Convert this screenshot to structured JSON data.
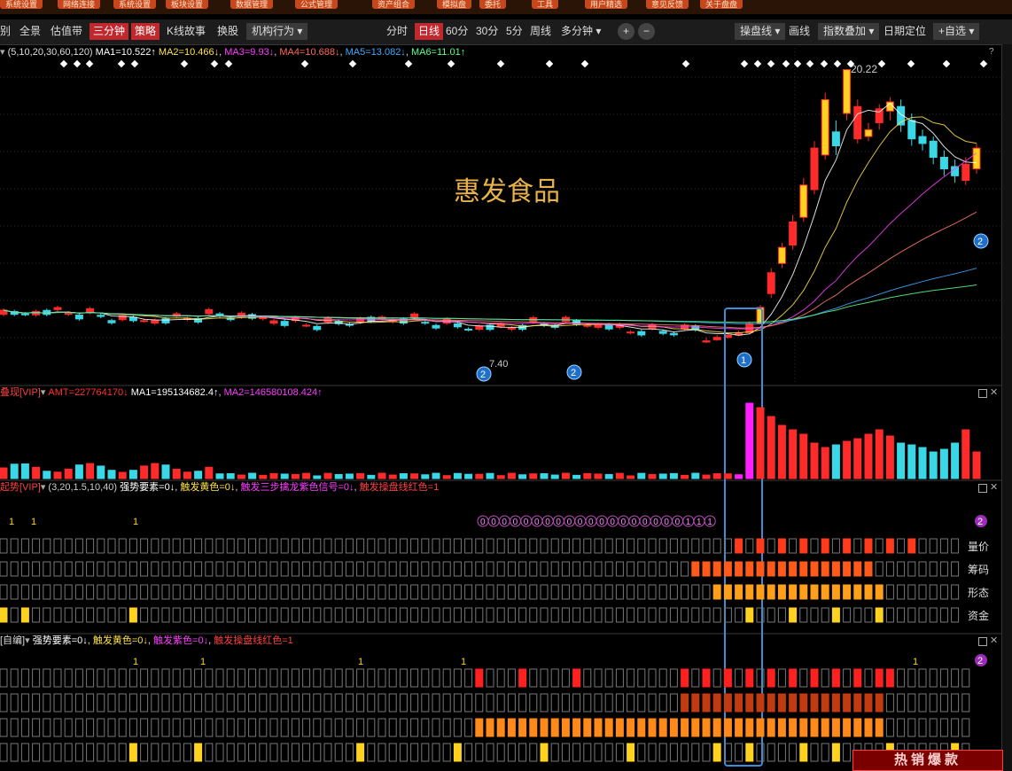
{
  "top_menu": [
    "系统设置",
    "网络连接",
    "系统设置",
    "板块设置",
    "数据管理",
    "公式管理",
    "资产组合",
    "模拟盘",
    "委托",
    "工具",
    "用户精选",
    "意见反馈",
    "关于盘盘"
  ],
  "toolbar": {
    "left_tabs": [
      "别",
      "全景",
      "估值带",
      "三分钟",
      "策略",
      "K线故事",
      "换股",
      "机构行为"
    ],
    "period_tabs": [
      "分时",
      "日线",
      "60分",
      "30分",
      "5分",
      "周线",
      "多分钟"
    ],
    "zoom_in": "+",
    "zoom_out": "−",
    "right_tabs": [
      "操盘线",
      "画线",
      "指数叠加",
      "日期定位",
      "+自选"
    ]
  },
  "ma_bar": {
    "params": "(5,10,20,30,60,120)",
    "ma1": "MA1=10.522↑",
    "ma2": "MA2=10.466↓",
    "ma3": "MA3=9.93↓",
    "ma4": "MA4=10.688↓",
    "ma5": "MA5=13.082↓",
    "ma6": "MA6=11.01↑",
    "help": "?"
  },
  "price_chart": {
    "stock_name": "惠发食品",
    "high_label": "20.22",
    "low_label": "7.40",
    "markers": [
      "2",
      "2",
      "1",
      "2"
    ]
  },
  "amount_bar": {
    "name": "叠现[VIP]",
    "amt": "AMT=227764170↓",
    "ma1": "MA1=195134682.4↑",
    "ma2": "MA2=146580108.424↑"
  },
  "indicator1_bar": {
    "name": "起势[VIP]",
    "params": "(3,20,1.5,10,40)",
    "f1": "强势要素=0↓",
    "f2": "触发黄色=0↓",
    "f3": "触发三步擒龙紫色信号=0↓",
    "f4": "触发操盘线红色=1"
  },
  "indicator1_rows": [
    "量价",
    "筹码",
    "形态",
    "资金"
  ],
  "indicator1_left_ones": [
    "1",
    "1",
    "1"
  ],
  "indicator1_digits": "0000000000000000000111",
  "indicator1_tail": "2",
  "indicator2_bar": {
    "name": "[自编]",
    "f1": "强势要素=0↓",
    "f2": "触发黄色=0↓",
    "f3": "触发紫色=0↓",
    "f4": "触发操盘线红色=1"
  },
  "indicator2_ones": [
    "1",
    "1",
    "1",
    "1",
    "1"
  ],
  "indicator2_tail": "2",
  "watermark": "热销爆款",
  "colors": {
    "up": "#ff2a2a",
    "down": "#3ad7e6",
    "yellow": "#ffd21f",
    "magenta": "#ff1fff",
    "orange": "#ff6a1a",
    "highlight_box": "#3b8fd8"
  }
}
